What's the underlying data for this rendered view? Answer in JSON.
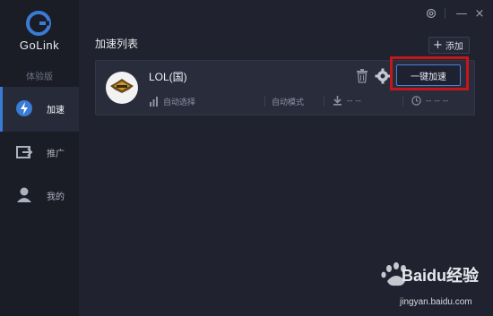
{
  "app": {
    "name": "GoLink",
    "edition": "体验版"
  },
  "sidebar": {
    "items": [
      {
        "label": "加速",
        "icon": "lightning-icon",
        "active": true
      },
      {
        "label": "推广",
        "icon": "share-icon",
        "active": false
      },
      {
        "label": "我的",
        "icon": "user-icon",
        "active": false
      }
    ]
  },
  "window_controls": {
    "settings": "⚙",
    "minimize": "—",
    "close": "×"
  },
  "main": {
    "title": "加速列表",
    "add_label": "添加",
    "games": [
      {
        "name": "LOL(国)",
        "boost_label": "一键加速",
        "node": "自动选择",
        "mode": "自动模式",
        "speed": "-- --",
        "latency": "-- -- --"
      }
    ]
  },
  "watermark": {
    "text": "Baidu经验",
    "url_text": "jingyan.baidu.com"
  },
  "colors": {
    "accent": "#3a7bd5",
    "highlight": "#c4171c",
    "background": "#20232f",
    "sidebar": "#1a1c26"
  }
}
